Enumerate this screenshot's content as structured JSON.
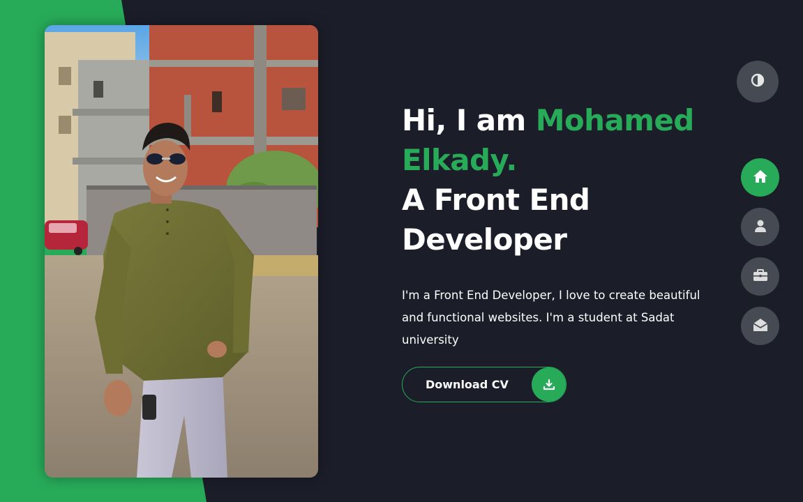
{
  "colors": {
    "accent": "#27ab59",
    "background": "#1b1d29",
    "button_gray": "#454a53",
    "text": "#ffffff"
  },
  "hero": {
    "greeting": "Hi, I am ",
    "name": "Mohamed Elkady.",
    "role_line_1": "A Front End",
    "role_line_2": "Developer",
    "description": "I'm a Front End Developer, I love to create beautiful and functional websites. I'm a student at Sadat university"
  },
  "cta": {
    "label": "Download CV",
    "icon": "download-icon"
  },
  "theme_toggle": {
    "icon": "contrast-icon"
  },
  "nav": {
    "items": [
      {
        "id": "home",
        "icon": "home-icon",
        "active": true
      },
      {
        "id": "about",
        "icon": "user-icon",
        "active": false
      },
      {
        "id": "portfolio",
        "icon": "briefcase-icon",
        "active": false
      },
      {
        "id": "contact",
        "icon": "envelope-open-icon",
        "active": false
      }
    ]
  },
  "photo": {
    "subject": "portrait-photo"
  }
}
